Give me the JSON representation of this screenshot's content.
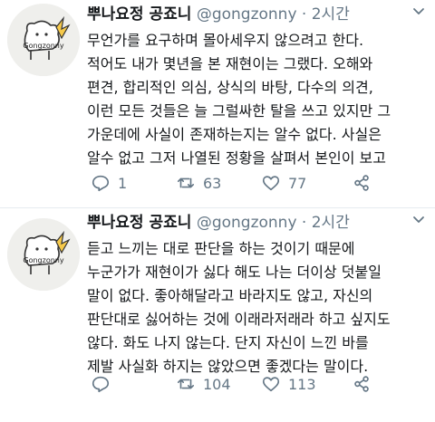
{
  "tweets": [
    {
      "display_name": "뿌나요정 공죠니",
      "handle": "@gongzonny",
      "separator": "·",
      "time": "2시간",
      "avatar_text": "Gongzonny",
      "text": "무언가를 요구하며 몰아세우지 않으려고 한다.\n적어도 내가 몇년을 본 재현이는 그랬다. 오해와\n편견, 합리적인 의심, 상식의 바탕, 다수의 의견,\n이런 모든 것들은 늘 그럴싸한 탈을 쓰고 있지만 그\n가운데에 사실이 존재하는지는 알수 없다. 사실은\n알수 없고 그저 나열된 정황을 살펴서 본인이 보고",
      "reply_count": "1",
      "retweet_count": "63",
      "like_count": "77",
      "icons": {
        "reply": "reply-icon",
        "retweet": "retweet-icon",
        "like": "heart-icon",
        "share": "share-icon",
        "more": "chevron-down-icon"
      }
    },
    {
      "display_name": "뿌나요정 공죠니",
      "handle": "@gongzonny",
      "separator": "·",
      "time": "2시간",
      "avatar_text": "Gongzonny",
      "text": "듣고 느끼는 대로 판단을 하는 것이기 때문에\n누군가가 재현이가 싫다 해도 나는 더이상 덧붙일\n말이 없다. 좋아해달라고 바라지도 않고, 자신의\n판단대로 싫어하는 것에 이래라저래라 하고 싶지도\n않다. 화도 나지 않는다. 단지 자신이 느낀 바를\n제발 사실화 하지는 않았으면 좋겠다는 말이다.",
      "reply_count": "",
      "retweet_count": "104",
      "like_count": "113"
    }
  ],
  "colors": {
    "text": "#14171a",
    "muted": "#657786",
    "divider": "#e6ecf0"
  }
}
